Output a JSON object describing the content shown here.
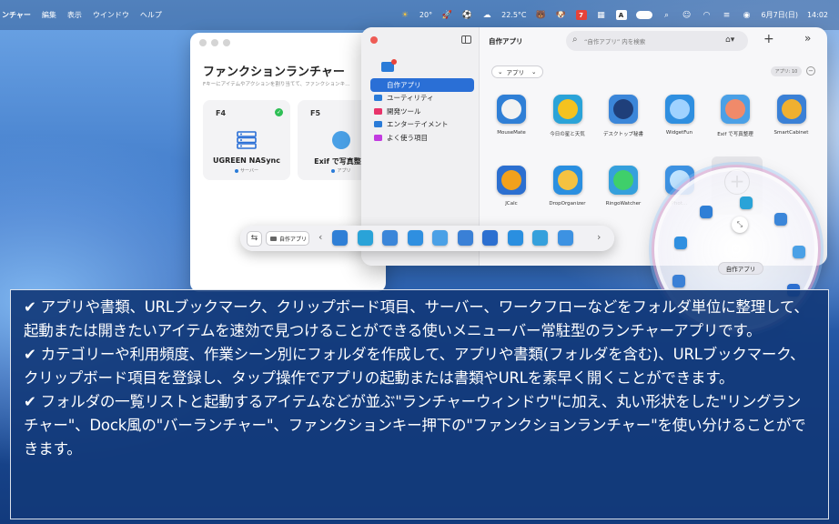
{
  "menubar": {
    "app_name": "ンチャー",
    "menus": [
      "編集",
      "表示",
      "ウインドウ",
      "ヘルプ"
    ],
    "weather_temp": "20°",
    "temp2": "22.5°C",
    "calendar_day": "7",
    "input_mode": "A",
    "date": "6月7日(日)",
    "time": "14:02"
  },
  "function_window": {
    "title": "ファンクションランチャー",
    "subtitle": "Fキーにアイテムやアクションを割り当てて、ファンクションキ…",
    "cards": [
      {
        "key": "F4",
        "name": "UGREEN NASync",
        "type": "サーバー"
      },
      {
        "key": "F5",
        "name": "Exif で写真整理",
        "type": "アプリ"
      }
    ]
  },
  "launcher": {
    "folder_title": "自作アプリ",
    "search_placeholder": "“自作アプリ” 内を検索",
    "sidebar": [
      {
        "label": "自作アプリ",
        "color": "#2a7bd8",
        "selected": true
      },
      {
        "label": "ユーティリティ",
        "color": "#2a7bd8",
        "selected": false
      },
      {
        "label": "開発ツール",
        "color": "#e8336a",
        "selected": false
      },
      {
        "label": "エンターテイメント",
        "color": "#2a7bd8",
        "selected": false
      },
      {
        "label": "よく使う項目",
        "color": "#c23be0",
        "selected": false
      }
    ],
    "sort_label": "アプリ",
    "count_label": "アプリ: 10",
    "apps_row1": [
      {
        "label": "MouseMate",
        "bg": "#2f7fd6",
        "inner": "#f2f2f2"
      },
      {
        "label": "今日の星と天気",
        "bg": "#2aa3d8",
        "inner": "#f4c21f"
      },
      {
        "label": "デスクトップ秘書",
        "bg": "#3b86d9",
        "inner": "#1f3f7a"
      },
      {
        "label": "WidgetFun",
        "bg": "#2f8fe0",
        "inner": "#9fd2ff"
      },
      {
        "label": "Exif で写真整理",
        "bg": "#4aa0e6",
        "inner": "#f08a6a"
      },
      {
        "label": "SmartCabinet",
        "bg": "#3a80d6",
        "inner": "#f0b030"
      }
    ],
    "apps_row2": [
      {
        "label": "JCalc",
        "bg": "#2c6fd0",
        "inner": "#f2a11c"
      },
      {
        "label": "DropOrganizer",
        "bg": "#2a8fe0",
        "inner": "#f5c241"
      },
      {
        "label": "RingoWatcher",
        "bg": "#35a0dc",
        "inner": "#3fcf6a"
      },
      {
        "label": "Phot…",
        "bg": "#3d92e2",
        "inner": "#bfe3ff"
      }
    ]
  },
  "bar_launcher": {
    "folder_label": "自作アプリ",
    "icons": [
      "#2f7fd6",
      "#2aa3d8",
      "#3b86d9",
      "#2f8fe0",
      "#4aa0e6",
      "#3a80d6",
      "#2c6fd0",
      "#2a8fe0",
      "#35a0dc",
      "#3d92e2"
    ]
  },
  "ring_launcher": {
    "label": "自作アプリ"
  },
  "description": {
    "lines": [
      "✔ アプリや書類、URLブックマーク、クリップボード項目、サーバー、ワークフローなどをフォルダ単位に整理して、起動または開きたいアイテムを速効で見つけることができる使いメニューバー常駐型のランチャーアプリです。",
      "✔ カテゴリーや利用頻度、作業シーン別にフォルダを作成して、アプリや書類(フォルダを含む)、URLブックマーク、クリップボード項目を登録し、タップ操作でアプリの起動または書類やURLを素早く開くことができます。",
      "✔ フォルダの一覧リストと起動するアイテムなどが並ぶ\"ランチャーウィンドウ\"に加え、丸い形状をした\"リングランチャー\"、Dock風の\"バーランチャー\"、ファンクションキー押下の\"ファンクションランチャー\"を使い分けることができます。"
    ]
  }
}
